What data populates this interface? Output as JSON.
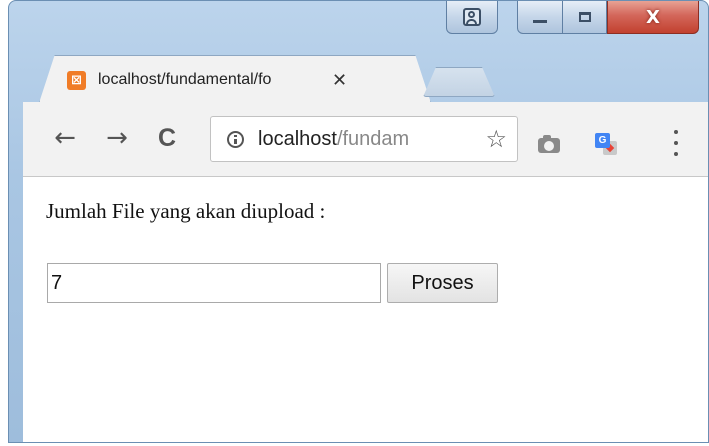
{
  "browser": {
    "tab": {
      "favicon_glyph": "⊠",
      "title": "localhost/fundamental/fo",
      "close_glyph": "✕"
    },
    "toolbar": {
      "back_glyph": "←",
      "forward_glyph": "→",
      "reload_glyph": "C",
      "url_host": "localhost",
      "url_path": "/fundam",
      "bookmark_glyph": "☆"
    },
    "window_controls": {
      "close_glyph": "X"
    },
    "icons": [
      "user-icon",
      "minimize-icon",
      "maximize-icon",
      "close-icon",
      "xampp-favicon",
      "info-icon",
      "star-icon",
      "camera-icon",
      "translate-icon",
      "menu-icon"
    ],
    "colors": {
      "favicon": "#f07c27",
      "close_button": "#c2412f",
      "chrome_frame": "#a9c6e3"
    }
  },
  "page": {
    "prompt": "Jumlah File yang akan diupload :",
    "input_value": "7",
    "button_label": "Proses"
  }
}
